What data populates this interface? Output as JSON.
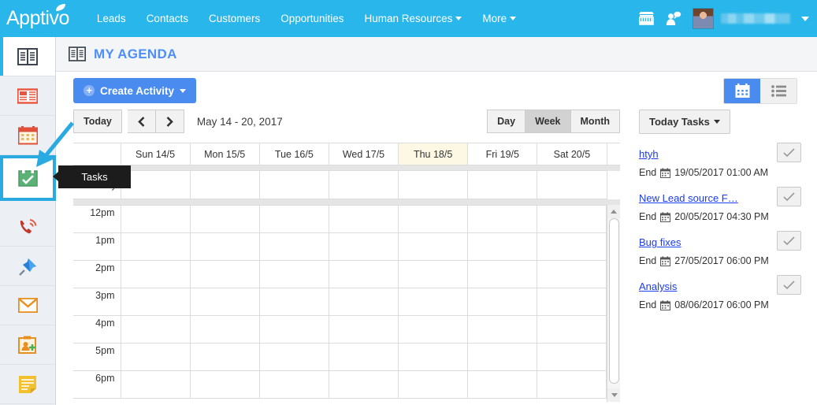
{
  "colors": {
    "brand_blue": "#29b6ea",
    "accent_blue": "#4a8bf0",
    "highlight_border": "#29abe2",
    "today_bg": "#fcf8e3",
    "link_blue": "#1b3ce8",
    "title_blue": "#4d8ef7"
  },
  "topnav": {
    "logo": "Apptivo",
    "items": [
      {
        "label": "Leads",
        "caret": false
      },
      {
        "label": "Contacts",
        "caret": false
      },
      {
        "label": "Customers",
        "caret": false
      },
      {
        "label": "Opportunities",
        "caret": false
      },
      {
        "label": "Human Resources",
        "caret": true
      },
      {
        "label": "More",
        "caret": true
      }
    ],
    "right_icons": [
      "store-icon",
      "messages-icon"
    ],
    "user_name": ""
  },
  "sidebar": {
    "items": [
      {
        "name": "agenda",
        "icon": "agenda-book-icon",
        "state": "active"
      },
      {
        "name": "news",
        "icon": "news-list-icon",
        "state": "normal"
      },
      {
        "name": "calendar",
        "icon": "calendar-icon",
        "state": "normal"
      },
      {
        "name": "tasks",
        "icon": "tasks-check-calendar-icon",
        "state": "selected"
      },
      {
        "name": "calls",
        "icon": "phone-call-icon",
        "state": "normal"
      },
      {
        "name": "pin",
        "icon": "pushpin-icon",
        "state": "normal"
      },
      {
        "name": "email",
        "icon": "envelope-icon",
        "state": "normal"
      },
      {
        "name": "contact-add",
        "icon": "contact-add-icon",
        "state": "normal"
      },
      {
        "name": "notes",
        "icon": "notes-icon",
        "state": "normal"
      }
    ]
  },
  "page": {
    "icon": "agenda-book-icon",
    "title": "MY AGENDA"
  },
  "toolbar": {
    "create_label": "Create Activity",
    "view_calendar_icon": "calendar-view-icon",
    "view_list_icon": "list-view-icon",
    "active_view": "calendar"
  },
  "calendar": {
    "today_label": "Today",
    "prev_label": "‹",
    "next_label": "›",
    "date_range": "May 14 - 20, 2017",
    "views": [
      {
        "label": "Day",
        "active": false
      },
      {
        "label": "Week",
        "active": true
      },
      {
        "label": "Month",
        "active": false
      }
    ],
    "day_headers": [
      {
        "label": "Sun 14/5",
        "today": false
      },
      {
        "label": "Mon 15/5",
        "today": false
      },
      {
        "label": "Tue 16/5",
        "today": false
      },
      {
        "label": "Wed 17/5",
        "today": false
      },
      {
        "label": "Thu 18/5",
        "today": true
      },
      {
        "label": "Fri 19/5",
        "today": false
      },
      {
        "label": "Sat 20/5",
        "today": false
      }
    ],
    "allday_label": "all day",
    "time_slots": [
      "12pm",
      "1pm",
      "2pm",
      "3pm",
      "4pm",
      "5pm",
      "6pm"
    ]
  },
  "task_panel": {
    "dropdown_label": "Today Tasks",
    "end_label": "End",
    "tasks": [
      {
        "title": "htyh",
        "end": "19/05/2017 01:00 AM"
      },
      {
        "title": "New Lead source F…",
        "end": "20/05/2017 04:30 PM"
      },
      {
        "title": "Bug fixes",
        "end": "27/05/2017 06:00 PM"
      },
      {
        "title": "Analysis",
        "end": "08/06/2017 06:00 PM"
      }
    ]
  },
  "annotation": {
    "tooltip_text": "Tasks",
    "arrow": "blue-arrow-pointing-to-tasks-sidebar-item"
  }
}
